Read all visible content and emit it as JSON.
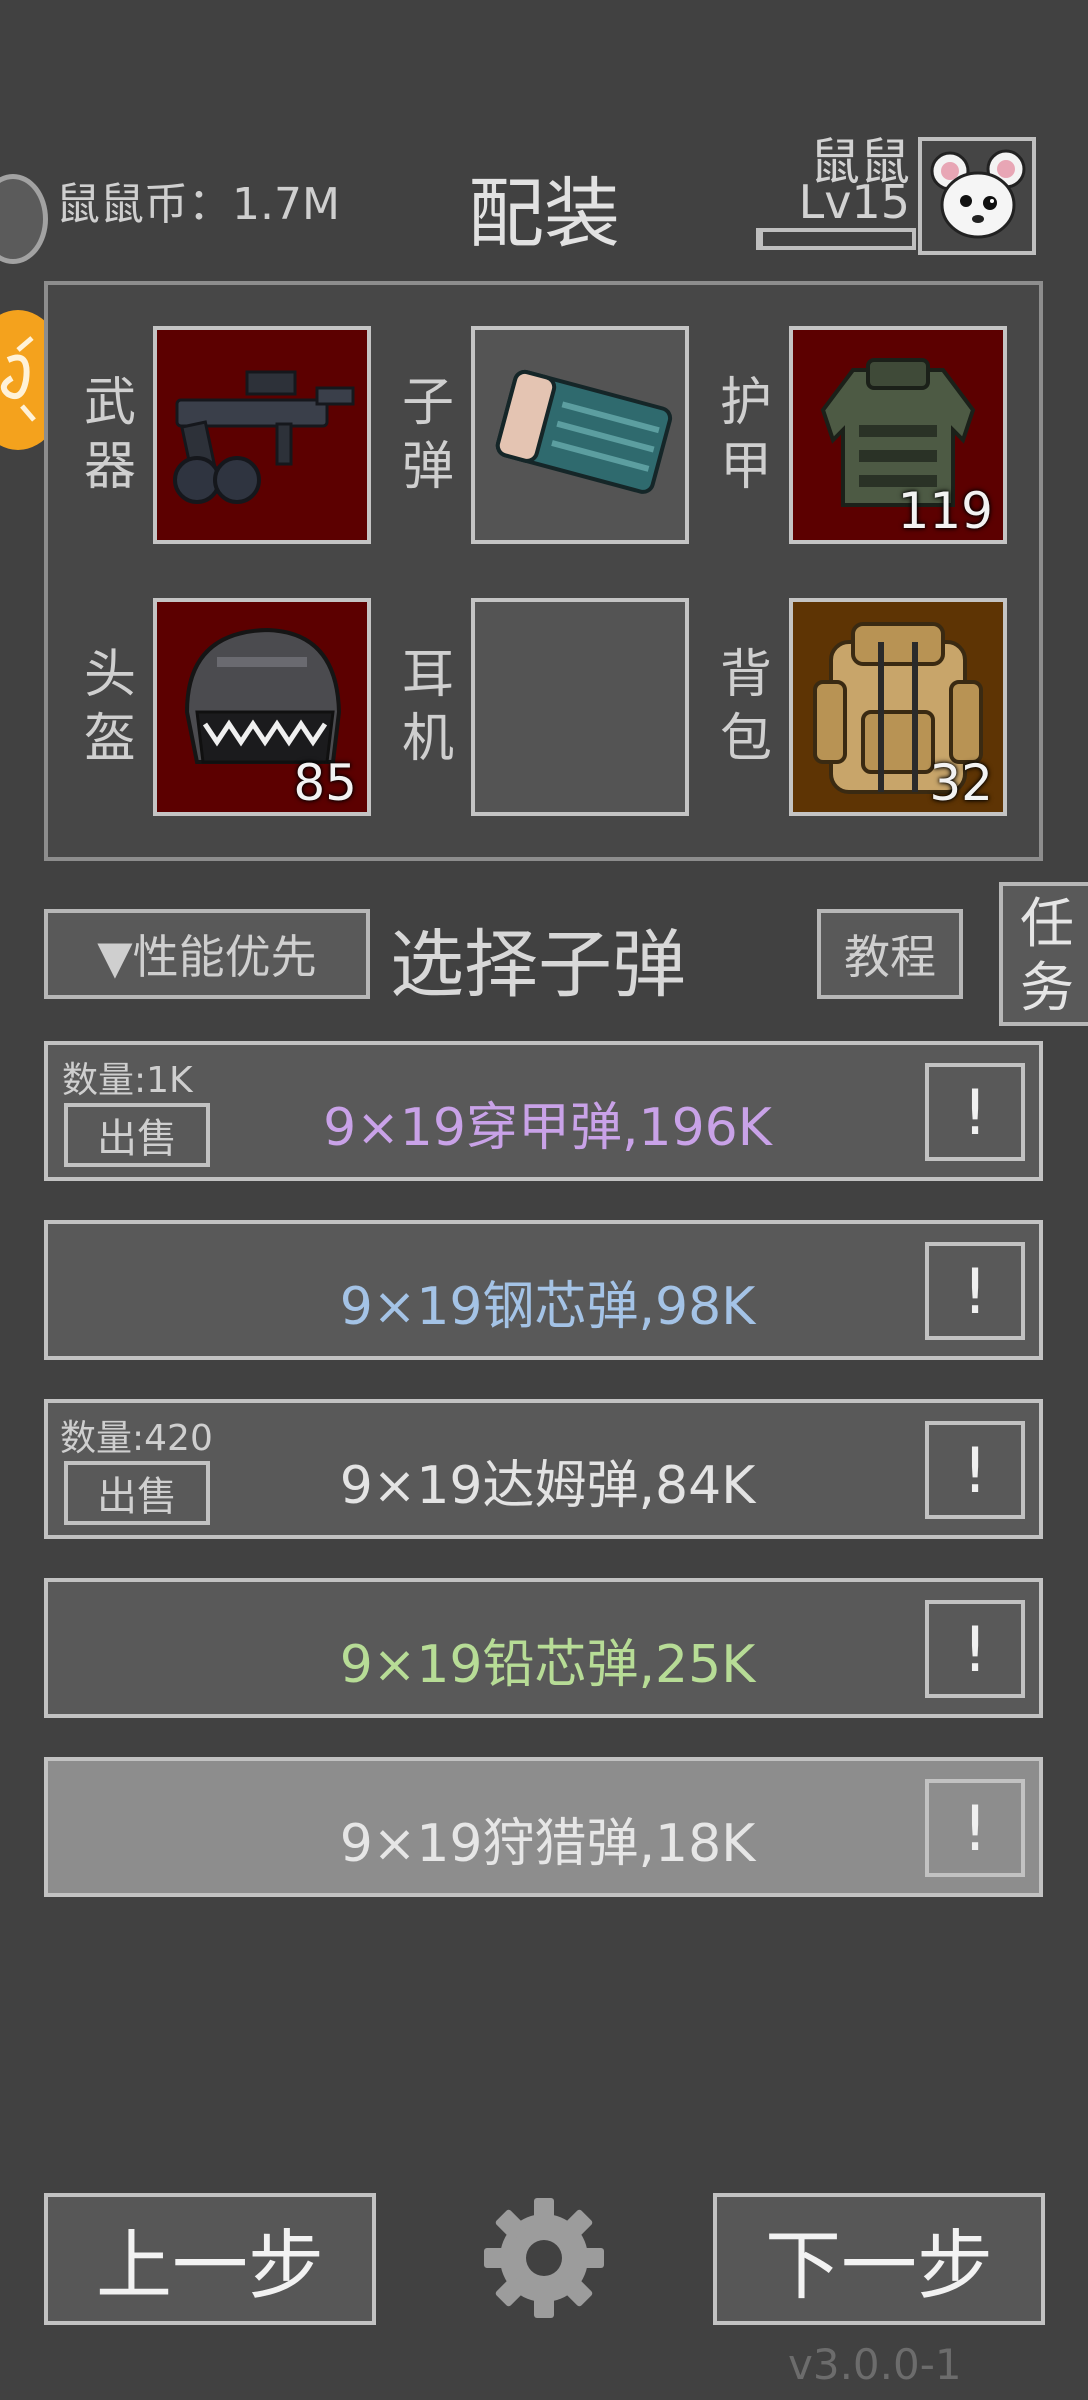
{
  "header": {
    "coins_text": "鼠鼠币：1.7M",
    "title": "配装",
    "player_name": "鼠鼠",
    "player_level": "Lv15",
    "level_progress": 0.02
  },
  "equipment": {
    "slots": [
      {
        "label": "武器",
        "icon": "rifle-icon",
        "count": "",
        "bg": "#5c0000"
      },
      {
        "label": "子弹",
        "icon": "ammo-box-icon",
        "count": "",
        "bg": "#545454"
      },
      {
        "label": "护甲",
        "icon": "body-armor-icon",
        "count": "119",
        "bg": "#5c0000"
      },
      {
        "label": "头盔",
        "icon": "helmet-icon",
        "count": "85",
        "bg": "#5c0000"
      },
      {
        "label": "耳机",
        "icon": "",
        "count": "",
        "bg": "#545454"
      },
      {
        "label": "背包",
        "icon": "backpack-icon",
        "count": "32",
        "bg": "#5e3404"
      }
    ]
  },
  "selection": {
    "sort_label": "▼性能优先",
    "title": "选择子弹",
    "tutorial_label": "教程",
    "task_label": "任务"
  },
  "ammo": [
    {
      "name": "9×19穿甲弹,196K",
      "color": "#c9a2e8",
      "quantity": "数量:1K",
      "sell": "出售",
      "info": "!"
    },
    {
      "name": "9×19钢芯弹,98K",
      "color": "#a4c3e6",
      "quantity": "",
      "sell": "",
      "info": "!"
    },
    {
      "name": "9×19达姆弹,84K",
      "color": "#e3e3e3",
      "quantity": "数量:420",
      "sell": "出售",
      "info": "!"
    },
    {
      "name": "9×19铅芯弹,25K",
      "color": "#b7dc96",
      "quantity": "",
      "sell": "",
      "info": "!"
    },
    {
      "name": "9×19狩猎弹,18K",
      "color": "#e6e6e6",
      "quantity": "",
      "sell": "",
      "info": "!"
    }
  ],
  "footer": {
    "prev_label": "上一步",
    "next_label": "下一步",
    "settings_icon": "gear-icon",
    "version": "v3.0.0-1"
  }
}
